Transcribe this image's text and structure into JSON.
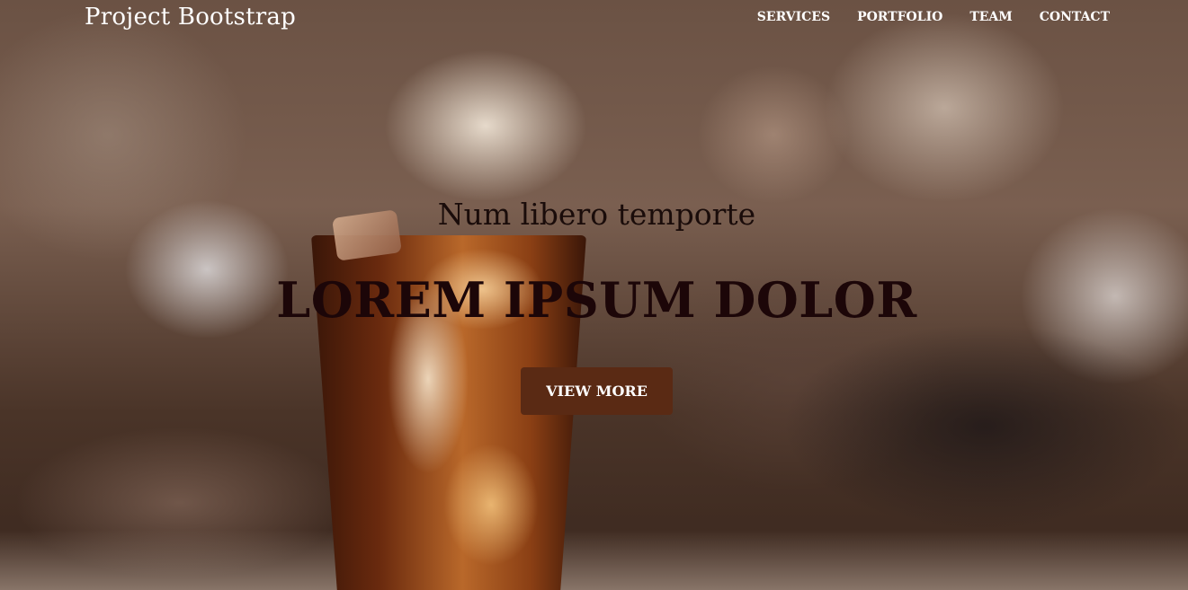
{
  "navbar": {
    "brand": "Project Bootstrap",
    "links": [
      {
        "label": "SERVICES"
      },
      {
        "label": "PORTFOLIO"
      },
      {
        "label": "TEAM"
      },
      {
        "label": "CONTACT"
      }
    ]
  },
  "hero": {
    "subtitle": "Num libero temporte",
    "headline": "LOREM IPSUM DOLOR",
    "cta_label": "VIEW MORE"
  },
  "colors": {
    "cta_background": "#5a2a14",
    "headline_text": "#1c0608",
    "nav_text": "#ffffff"
  }
}
